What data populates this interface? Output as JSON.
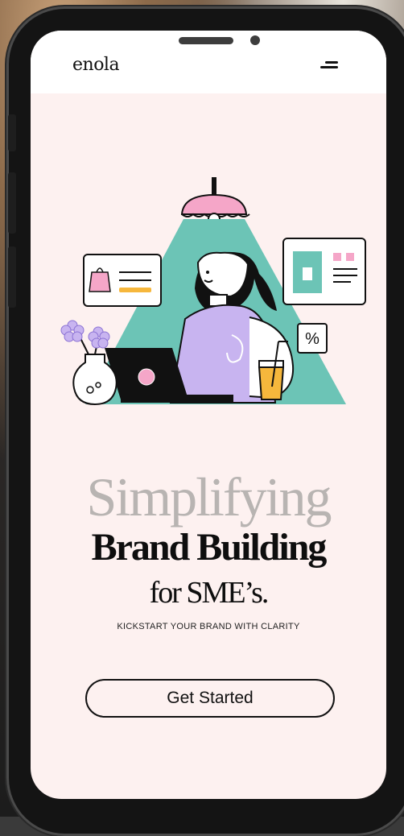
{
  "brand": {
    "name": "enola"
  },
  "hero": {
    "headline_1": "Simplifying",
    "headline_2": "Brand Building",
    "headline_3": "for SME’s.",
    "tagline": "KICKSTART YOUR BRAND WITH CLARITY",
    "cta_label": "Get Started"
  },
  "icons": {
    "menu": "menu-icon",
    "percent_card_text": "%"
  },
  "colors": {
    "background": "#fdf1f0",
    "teal_light": "#6cc4b6",
    "lamp_pink": "#f5a6c8",
    "lavender": "#c8b4f0",
    "juice": "#f6b73c"
  }
}
